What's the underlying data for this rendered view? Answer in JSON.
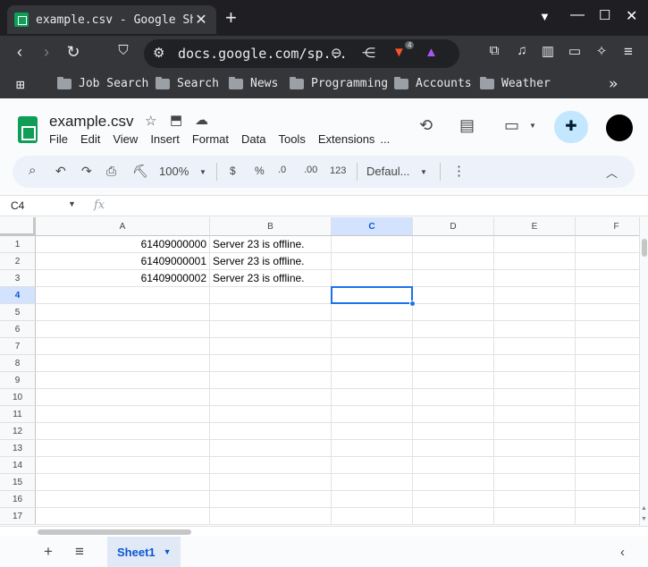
{
  "browser": {
    "tab_title": "example.csv - Google She",
    "close_glyph": "✕",
    "newtab_glyph": "+",
    "url": "docs.google.com/sp...",
    "brave_badge": "4",
    "bookmarks": [
      "Job Search",
      "Search",
      "News",
      "Programming",
      "Accounts",
      "Weather"
    ],
    "overflow_glyph": "»"
  },
  "doc": {
    "title": "example.csv",
    "menu": [
      "File",
      "Edit",
      "View",
      "Insert",
      "Format",
      "Data",
      "Tools",
      "Extensions",
      "..."
    ]
  },
  "toolbar": {
    "zoom": "100%",
    "currency": "$",
    "percent": "%",
    "decrease_decimal": ".0",
    "increase_decimal": ".00",
    "number_format": "123",
    "font": "Defaul..."
  },
  "formula_bar": {
    "cell_ref": "C4",
    "fx": "fx"
  },
  "grid": {
    "columns": [
      "A",
      "B",
      "C",
      "D",
      "E",
      "F"
    ],
    "selected_column": "C",
    "rows": [
      "1",
      "2",
      "3",
      "4",
      "5",
      "6",
      "7",
      "8",
      "9",
      "10",
      "11",
      "12",
      "13",
      "14",
      "15",
      "16",
      "17"
    ],
    "selected_row": "4",
    "data": [
      [
        "61409000000",
        "Server 23 is offline."
      ],
      [
        "61409000001",
        "Server 23 is offline."
      ],
      [
        "61409000002",
        "Server 23 is offline."
      ]
    ]
  },
  "sheets": {
    "add": "+",
    "list": "≡",
    "active": "Sheet1"
  }
}
